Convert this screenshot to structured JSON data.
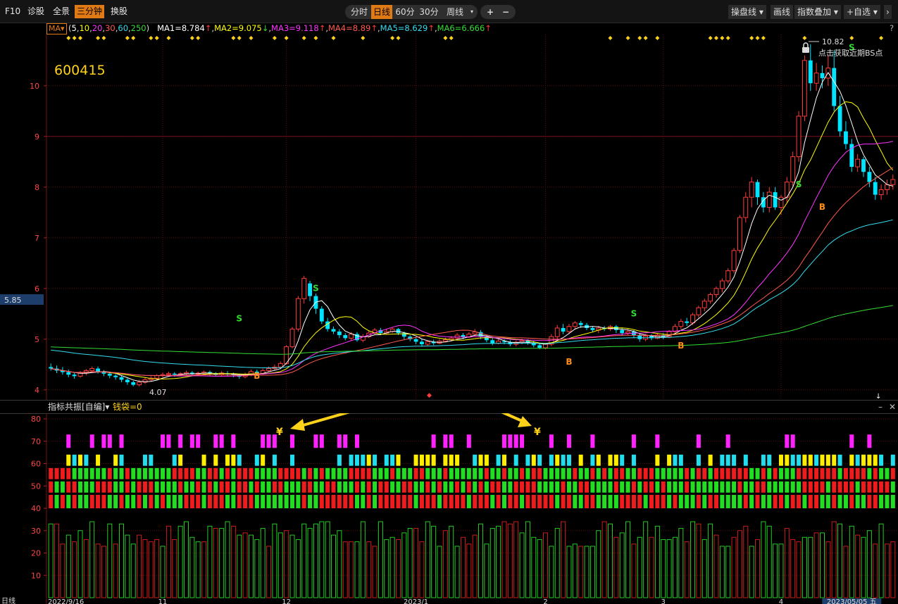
{
  "toolbar": {
    "left": [
      "F10",
      "诊股",
      "全景",
      "三分钟",
      "换股"
    ],
    "active_left": "三分钟",
    "periods": [
      "分时",
      "日线",
      "60分",
      "30分",
      "周线"
    ],
    "active_period": "日线",
    "right": [
      "操盘线",
      "画线",
      "指数叠加",
      "+自选"
    ]
  },
  "ma_bar": {
    "selector": "MA",
    "params_prefix": "(",
    "params": [
      "5",
      "10",
      "20",
      "30",
      "60",
      "250"
    ],
    "params_suffix": ")",
    "values": [
      {
        "label": "MA1=8.784",
        "arrow": "↑"
      },
      {
        "label": "MA2=9.075",
        "arrow": "↓"
      },
      {
        "label": "MA3=9.118",
        "arrow": "↑"
      },
      {
        "label": "MA4=8.89",
        "arrow": "↑"
      },
      {
        "label": "MA5=8.629",
        "arrow": "↑"
      },
      {
        "label": "MA6=6.666",
        "arrow": "↑"
      }
    ],
    "help": "?"
  },
  "colors": {
    "up": "#ff3b3b",
    "down": "#00e5ff",
    "ma1": "#ffffff",
    "ma2": "#ffff00",
    "ma3": "#ff33ff",
    "ma4": "#ff5a4f",
    "ma5": "#33ddee",
    "ma6": "#33dd33"
  },
  "main_chart": {
    "stock_code": "600415",
    "price_marker": "5.85",
    "high_label": "10.82",
    "low_label": "4.07",
    "bs_tip": "点击获取近期BS点",
    "y_ticks": [
      "4",
      "5",
      "6",
      "7",
      "8",
      "9",
      "10"
    ],
    "signals": [
      {
        "text": "S",
        "i": 32,
        "v": 5.35
      },
      {
        "text": "B",
        "i": 35,
        "v": 4.22
      },
      {
        "text": "S",
        "i": 45,
        "v": 5.95
      },
      {
        "text": "B",
        "i": 88,
        "v": 4.5
      },
      {
        "text": "S",
        "i": 99,
        "v": 5.45
      },
      {
        "text": "B",
        "i": 107,
        "v": 4.82
      },
      {
        "text": "S",
        "i": 127,
        "v": 8.0
      },
      {
        "text": "B",
        "i": 131,
        "v": 7.55
      },
      {
        "text": "S",
        "i": 136,
        "v": 10.7
      }
    ]
  },
  "indicator_panel": {
    "title": "指标共振[自编]",
    "extra": "钱袋=0",
    "y_ticks": [
      "10",
      "20",
      "30",
      "40",
      "50",
      "60",
      "70",
      "80"
    ],
    "yen": "¥",
    "bottom_left": "日线"
  },
  "x_axis": {
    "labels": [
      "2022/9/16",
      "11",
      "12",
      "2023/1",
      "2",
      "3",
      "4",
      "2023/05/05 五"
    ]
  },
  "chart_data": {
    "type": "candlestick",
    "ylim": [
      3.9,
      10.9
    ],
    "candles": [
      [
        4.45,
        4.42,
        4.52,
        4.38
      ],
      [
        4.42,
        4.38,
        4.48,
        4.33
      ],
      [
        4.38,
        4.35,
        4.45,
        4.3
      ],
      [
        4.35,
        4.3,
        4.4,
        4.25
      ],
      [
        4.3,
        4.27,
        4.35,
        4.22
      ],
      [
        4.27,
        4.33,
        4.37,
        4.24
      ],
      [
        4.33,
        4.38,
        4.41,
        4.29
      ],
      [
        4.38,
        4.42,
        4.46,
        4.35
      ],
      [
        4.42,
        4.36,
        4.46,
        4.32
      ],
      [
        4.36,
        4.32,
        4.39,
        4.27
      ],
      [
        4.32,
        4.28,
        4.35,
        4.23
      ],
      [
        4.28,
        4.25,
        4.31,
        4.2
      ],
      [
        4.25,
        4.2,
        4.28,
        4.15
      ],
      [
        4.2,
        4.15,
        4.23,
        4.1
      ],
      [
        4.15,
        4.1,
        4.18,
        4.07
      ],
      [
        4.1,
        4.15,
        4.2,
        4.07
      ],
      [
        4.15,
        4.2,
        4.24,
        4.12
      ],
      [
        4.2,
        4.23,
        4.27,
        4.16
      ],
      [
        4.23,
        4.28,
        4.31,
        4.2
      ],
      [
        4.28,
        4.3,
        4.34,
        4.25
      ],
      [
        4.3,
        4.32,
        4.36,
        4.26
      ],
      [
        4.32,
        4.3,
        4.35,
        4.26
      ],
      [
        4.3,
        4.32,
        4.35,
        4.27
      ],
      [
        4.32,
        4.34,
        4.38,
        4.28
      ],
      [
        4.34,
        4.31,
        4.37,
        4.27
      ],
      [
        4.31,
        4.33,
        4.36,
        4.28
      ],
      [
        4.33,
        4.35,
        4.38,
        4.29
      ],
      [
        4.35,
        4.32,
        4.38,
        4.28
      ],
      [
        4.32,
        4.3,
        4.35,
        4.26
      ],
      [
        4.3,
        4.33,
        4.37,
        4.27
      ],
      [
        4.33,
        4.31,
        4.37,
        4.27
      ],
      [
        4.31,
        4.29,
        4.34,
        4.25
      ],
      [
        4.29,
        4.26,
        4.32,
        4.22
      ],
      [
        4.26,
        4.3,
        4.34,
        4.23
      ],
      [
        4.3,
        4.36,
        4.4,
        4.27
      ],
      [
        4.36,
        4.32,
        4.4,
        4.28
      ],
      [
        4.32,
        4.38,
        4.42,
        4.3
      ],
      [
        4.38,
        4.42,
        4.46,
        4.35
      ],
      [
        4.42,
        4.45,
        4.5,
        4.39
      ],
      [
        4.45,
        4.52,
        4.56,
        4.42
      ],
      [
        4.52,
        4.85,
        4.88,
        4.5
      ],
      [
        4.85,
        5.2,
        5.24,
        4.82
      ],
      [
        5.2,
        5.8,
        5.85,
        5.15
      ],
      [
        5.8,
        6.2,
        6.25,
        5.7
      ],
      [
        6.1,
        5.85,
        6.15,
        5.75
      ],
      [
        5.85,
        5.6,
        5.9,
        5.5
      ],
      [
        5.6,
        5.35,
        5.65,
        5.3
      ],
      [
        5.35,
        5.2,
        5.42,
        5.15
      ],
      [
        5.2,
        5.15,
        5.25,
        5.1
      ],
      [
        5.15,
        5.08,
        5.2,
        5.02
      ],
      [
        5.08,
        5.02,
        5.12,
        4.98
      ],
      [
        5.02,
        5.1,
        5.14,
        4.98
      ],
      [
        5.1,
        4.98,
        5.14,
        4.95
      ],
      [
        4.98,
        5.05,
        5.1,
        4.94
      ],
      [
        5.05,
        5.12,
        5.16,
        5.02
      ],
      [
        5.12,
        5.18,
        5.22,
        5.08
      ],
      [
        5.18,
        5.12,
        5.22,
        5.08
      ],
      [
        5.12,
        5.15,
        5.2,
        5.1
      ],
      [
        5.15,
        5.2,
        5.24,
        5.12
      ],
      [
        5.2,
        5.12,
        5.22,
        5.08
      ],
      [
        5.12,
        5.05,
        5.15,
        5.0
      ],
      [
        5.05,
        5.0,
        5.08,
        4.96
      ],
      [
        5.0,
        4.95,
        5.04,
        4.9
      ],
      [
        4.95,
        4.9,
        5.0,
        4.85
      ],
      [
        4.9,
        4.95,
        4.98,
        4.86
      ],
      [
        4.95,
        4.92,
        4.99,
        4.88
      ],
      [
        4.92,
        4.96,
        5.0,
        4.9
      ],
      [
        4.96,
        4.99,
        5.03,
        4.94
      ],
      [
        4.99,
        5.02,
        5.06,
        4.96
      ],
      [
        5.02,
        5.08,
        5.12,
        5.0
      ],
      [
        5.08,
        5.04,
        5.12,
        5.0
      ],
      [
        5.04,
        5.1,
        5.14,
        5.02
      ],
      [
        5.1,
        5.14,
        5.2,
        5.06
      ],
      [
        5.14,
        5.05,
        5.18,
        5.0
      ],
      [
        5.05,
        4.98,
        5.08,
        4.94
      ],
      [
        4.98,
        4.92,
        5.02,
        4.88
      ],
      [
        4.92,
        4.96,
        5.0,
        4.9
      ],
      [
        4.96,
        4.94,
        5.0,
        4.9
      ],
      [
        4.94,
        4.9,
        4.98,
        4.86
      ],
      [
        4.9,
        4.94,
        4.97,
        4.86
      ],
      [
        4.94,
        4.97,
        5.01,
        4.9
      ],
      [
        4.97,
        4.93,
        5.0,
        4.89
      ],
      [
        4.93,
        4.88,
        4.97,
        4.84
      ],
      [
        4.88,
        4.83,
        4.92,
        4.8
      ],
      [
        4.83,
        4.9,
        4.93,
        4.8
      ],
      [
        4.9,
        5.05,
        5.1,
        4.86
      ],
      [
        5.05,
        5.22,
        5.28,
        5.0
      ],
      [
        5.22,
        5.15,
        5.3,
        5.1
      ],
      [
        5.15,
        5.25,
        5.3,
        5.1
      ],
      [
        5.25,
        5.32,
        5.36,
        5.2
      ],
      [
        5.32,
        5.28,
        5.36,
        5.22
      ],
      [
        5.28,
        5.22,
        5.32,
        5.18
      ],
      [
        5.22,
        5.18,
        5.26,
        5.14
      ],
      [
        5.18,
        5.22,
        5.26,
        5.12
      ],
      [
        5.22,
        5.2,
        5.26,
        5.16
      ],
      [
        5.2,
        5.25,
        5.28,
        5.16
      ],
      [
        5.25,
        5.18,
        5.28,
        5.12
      ],
      [
        5.18,
        5.12,
        5.22,
        5.08
      ],
      [
        5.12,
        5.15,
        5.2,
        5.08
      ],
      [
        5.15,
        5.08,
        5.18,
        5.02
      ],
      [
        5.08,
        5.0,
        5.12,
        4.95
      ],
      [
        5.0,
        5.06,
        5.1,
        4.96
      ],
      [
        5.06,
        5.02,
        5.1,
        4.98
      ],
      [
        5.02,
        5.08,
        5.12,
        5.0
      ],
      [
        5.08,
        5.05,
        5.12,
        5.0
      ],
      [
        5.05,
        5.15,
        5.18,
        5.02
      ],
      [
        5.15,
        5.25,
        5.3,
        5.1
      ],
      [
        5.25,
        5.35,
        5.4,
        5.2
      ],
      [
        5.35,
        5.32,
        5.42,
        5.26
      ],
      [
        5.32,
        5.48,
        5.52,
        5.28
      ],
      [
        5.48,
        5.62,
        5.66,
        5.42
      ],
      [
        5.62,
        5.75,
        5.8,
        5.55
      ],
      [
        5.75,
        5.88,
        5.92,
        5.7
      ],
      [
        5.88,
        6.0,
        6.04,
        5.82
      ],
      [
        6.0,
        6.15,
        6.2,
        5.92
      ],
      [
        6.15,
        6.35,
        6.4,
        6.1
      ],
      [
        6.35,
        6.75,
        6.8,
        6.3
      ],
      [
        6.75,
        7.4,
        7.45,
        6.7
      ],
      [
        7.4,
        7.8,
        7.9,
        7.3
      ],
      [
        7.8,
        8.1,
        8.2,
        7.6
      ],
      [
        8.1,
        7.8,
        8.15,
        7.65
      ],
      [
        7.8,
        7.6,
        7.9,
        7.5
      ],
      [
        7.6,
        7.9,
        8.0,
        7.5
      ],
      [
        7.9,
        7.6,
        8.0,
        7.55
      ],
      [
        7.6,
        7.8,
        7.85,
        7.45
      ],
      [
        7.8,
        8.1,
        8.2,
        7.7
      ],
      [
        8.1,
        8.6,
        8.7,
        8.0
      ],
      [
        8.6,
        9.4,
        9.5,
        8.5
      ],
      [
        9.4,
        10.5,
        10.6,
        9.3
      ],
      [
        10.5,
        10.05,
        10.82,
        9.9
      ],
      [
        10.05,
        10.25,
        10.45,
        9.9
      ],
      [
        10.25,
        10.15,
        10.4,
        9.95
      ],
      [
        10.15,
        10.35,
        10.6,
        10.0
      ],
      [
        10.35,
        9.6,
        10.7,
        9.5
      ],
      [
        9.6,
        9.1,
        9.8,
        9.0
      ],
      [
        9.1,
        8.85,
        9.3,
        8.75
      ],
      [
        8.85,
        8.4,
        8.95,
        8.3
      ],
      [
        8.4,
        8.55,
        8.65,
        8.3
      ],
      [
        8.55,
        8.3,
        8.6,
        8.2
      ],
      [
        8.3,
        8.1,
        8.4,
        8.0
      ],
      [
        8.1,
        7.85,
        8.2,
        7.75
      ],
      [
        7.85,
        7.95,
        8.05,
        7.75
      ],
      [
        7.95,
        8.05,
        8.15,
        7.85
      ],
      [
        8.05,
        8.15,
        8.25,
        7.95
      ]
    ]
  }
}
